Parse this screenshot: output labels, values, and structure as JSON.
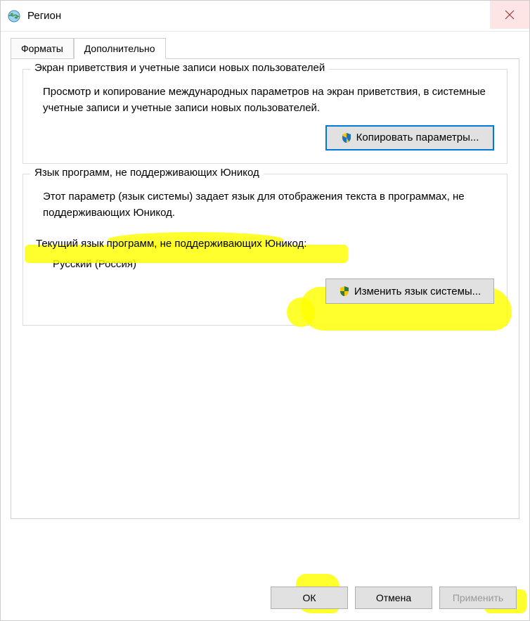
{
  "window": {
    "title": "Регион"
  },
  "tabs": {
    "formats": "Форматы",
    "advanced": "Дополнительно"
  },
  "group1": {
    "legend": "Экран приветствия и учетные записи новых пользователей",
    "text": "Просмотр и копирование международных параметров на экран приветствия, в системные учетные записи и учетные записи новых пользователей.",
    "button": "Копировать параметры..."
  },
  "group2": {
    "legend": "Язык программ, не поддерживающих Юникод",
    "text": "Этот параметр (язык системы) задает язык для отображения текста в программах, не поддерживающих Юникод.",
    "current_label": "Текущий язык программ, не поддерживающих Юникод:",
    "current_value": "Русский (Россия)",
    "button": "Изменить язык системы..."
  },
  "buttons": {
    "ok": "ОК",
    "cancel": "Отмена",
    "apply": "Применить"
  }
}
